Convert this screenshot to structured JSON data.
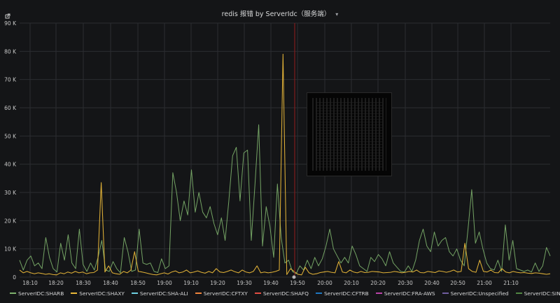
{
  "panel": {
    "title": "redis 报错 by ServerIdc（服务端）",
    "share_icon": "share-icon",
    "title_dropdown_icon": "chevron-down-icon"
  },
  "chart_data": {
    "type": "line",
    "title": "redis 报错 by ServerIdc（服务端）",
    "xlabel": "",
    "ylabel": "",
    "ylim": [
      0,
      90000
    ],
    "yticks": [
      "90 K",
      "80 K",
      "70 K",
      "60 K",
      "50 K",
      "40 K",
      "30 K",
      "20 K",
      "10 K",
      "0"
    ],
    "xticks": [
      "18:10",
      "18:20",
      "18:30",
      "18:40",
      "18:50",
      "19:00",
      "19:10",
      "19:20",
      "19:30",
      "19:40",
      "19:50",
      "20:00",
      "20:10",
      "20:20",
      "20:30",
      "20:40",
      "20:50",
      "21:00",
      "21:10"
    ],
    "grid": true,
    "legend": "bottom",
    "series": [
      {
        "name": "ServerIDC:SHARB",
        "color": "#7eb26d",
        "values": [
          6000,
          2500,
          6000,
          7500,
          4000,
          5000,
          3000,
          14000,
          7000,
          3000,
          1800,
          12000,
          6000,
          15000,
          5000,
          3000,
          17000,
          4500,
          2000,
          5000,
          2500,
          7000,
          13000,
          2500,
          2000,
          5500,
          3000,
          1500,
          14000,
          9000,
          2000,
          2500,
          17000,
          5000,
          4500,
          5000,
          2000,
          1600,
          6500,
          3000,
          4000,
          37000,
          30000,
          20000,
          27000,
          22000,
          38000,
          23000,
          30000,
          23000,
          21000,
          25000,
          19000,
          15000,
          21000,
          13000,
          27000,
          43000,
          46000,
          27000,
          44000,
          45000,
          13000,
          33000,
          54000,
          11000,
          25000,
          18000,
          7000,
          33000,
          14000,
          5000,
          6000,
          2000,
          1200,
          4000,
          2500,
          6000,
          3000,
          7000,
          4000,
          6500,
          11000,
          17000,
          10000,
          7500,
          5000,
          7000,
          5000,
          11000,
          8000,
          4000,
          3000,
          2000,
          7000,
          5500,
          8000,
          6500,
          4000,
          9000,
          5000,
          3500,
          2000,
          1800,
          4000,
          2000,
          6000,
          13000,
          17000,
          11000,
          9000,
          16000,
          11000,
          13000,
          14000,
          9000,
          7500,
          10000,
          6000,
          4000,
          17000,
          31000,
          12000,
          16000,
          10000,
          5000,
          3000,
          2500,
          6000,
          2000,
          18500,
          6000,
          13000,
          3000,
          2500,
          2000,
          2500,
          1800,
          5000,
          2000,
          4000,
          10500,
          7500
        ]
      },
      {
        "name": "ServerIDC:SHAXY",
        "color": "#eab839",
        "values": [
          2500,
          1500,
          2000,
          1500,
          1200,
          1500,
          1300,
          1000,
          1200,
          900,
          800,
          1500,
          1200,
          1800,
          1400,
          2000,
          1500,
          1800,
          1200,
          1500,
          1600,
          2500,
          33500,
          1800,
          4000,
          1500,
          1200,
          1000,
          2000,
          1500,
          2500,
          9000,
          2000,
          1800,
          1500,
          1200,
          900,
          800,
          1200,
          1500,
          1100,
          1800,
          2200,
          1500,
          1800,
          2500,
          1500,
          1800,
          2200,
          1700,
          1400,
          2000,
          1500,
          3000,
          1800,
          1600,
          2000,
          2500,
          1900,
          1500,
          2500,
          1800,
          1500,
          2000,
          4000,
          1500,
          1800,
          1500,
          1700,
          2000,
          2500,
          79000,
          900,
          3000,
          2000,
          1000,
          800,
          3500,
          1500,
          1000,
          1200,
          1600,
          1800,
          2000,
          1700,
          1500,
          5500,
          1800,
          1500,
          2500,
          1800,
          1500,
          2000,
          1600,
          1700,
          2000,
          1900,
          1800,
          1500,
          1600,
          1700,
          2000,
          1800,
          1500,
          1700,
          2000,
          1800,
          2500,
          1600,
          1500,
          2000,
          1800,
          1600,
          2200,
          2000,
          1700,
          2000,
          2500,
          1800,
          2000,
          12000,
          3000,
          2000,
          1700,
          6000,
          2000,
          1800,
          2500,
          1600,
          1500,
          3000,
          1800,
          1500,
          2000,
          1700,
          1500,
          1600,
          1400,
          1300,
          1500,
          1400,
          1200,
          1000,
          1200
        ]
      },
      {
        "name": "ServerIDC:SHA-ALI",
        "color": "#6ed0e0",
        "values": [
          0
        ]
      },
      {
        "name": "ServerIDC:CFTXY",
        "color": "#ef843c",
        "values": [
          0
        ]
      },
      {
        "name": "ServerIDC:SHAFQ",
        "color": "#e24d42",
        "values": [
          0
        ]
      },
      {
        "name": "ServerIDC:CFTRB",
        "color": "#1f78c1",
        "values": [
          0
        ]
      },
      {
        "name": "ServerIDC:FRA-AWS",
        "color": "#ba43a9",
        "values": [
          0
        ]
      },
      {
        "name": "ServerIDC:Unspecified",
        "color": "#705da0",
        "values": [
          0
        ]
      },
      {
        "name": "ServerIDC:SIN-AWS",
        "color": "#508642",
        "values": [
          0
        ]
      }
    ]
  },
  "legend": [
    {
      "label": "ServerIDC:SHARB",
      "color": "#7eb26d"
    },
    {
      "label": "ServerIDC:SHAXY",
      "color": "#eab839"
    },
    {
      "label": "ServerIDC:SHA-ALI",
      "color": "#6ed0e0"
    },
    {
      "label": "ServerIDC:CFTXY",
      "color": "#ef843c"
    },
    {
      "label": "ServerIDC:SHAFQ",
      "color": "#e24d42"
    },
    {
      "label": "ServerIDC:CFTRB",
      "color": "#1f78c1"
    },
    {
      "label": "ServerIDC:FRA-AWS",
      "color": "#ba43a9"
    },
    {
      "label": "ServerIDC:Unspecified",
      "color": "#705da0"
    },
    {
      "label": "ServerIDC:SIN-AWS",
      "color": "#508642"
    }
  ]
}
